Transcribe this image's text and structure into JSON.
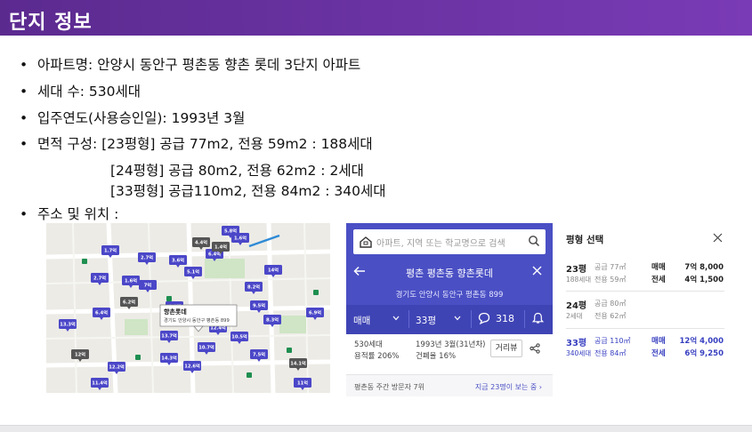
{
  "header": {
    "title": "단지 정보"
  },
  "bullets": {
    "name": "아파트명: 안양시 동안구 평촌동 향촌 롯데 3단지 아파트",
    "households": "세대 수: 530세대",
    "move_in": "입주연도(사용승인일): 1993년 3월",
    "area_intro": "면적 구성: [23평형] 공급 77m2, 전용 59m2 : 188세대",
    "area_24": "[24평형] 공급 80m2, 전용 62m2 : 2세대",
    "area_33": "[33평형] 공급110m2, 전용 84m2 : 340세대",
    "address": "주소   및 위치 :"
  },
  "map": {
    "callout_line1": "향촌롯데",
    "callout_line2": "경기도 안양시 동안구 평촌동 899",
    "pins": [
      "1.7억",
      "2.7억",
      "3.6억",
      "4.4억",
      "6.4억",
      "5.8억",
      "1.6억",
      "2.7억",
      "7억",
      "5.1억",
      "6.2억",
      "6.4억",
      "12.4억",
      "13.3억",
      "10.5억",
      "4.4억",
      "13.7억",
      "12억",
      "12.2억",
      "9.5억",
      "8.2억",
      "12.6억",
      "11.4억",
      "14.3억",
      "14.1억",
      "10.7억",
      "7.5억",
      "6.9억",
      "8.3억",
      "11억",
      "14억",
      "1.4억",
      "1.6억"
    ],
    "colors": {
      "pin": "#4b47c8",
      "pin_gray": "#555555",
      "pin_green": "#1e8f50",
      "road": "#ffffff",
      "park": "#cfe5c5"
    }
  },
  "phone": {
    "search_placeholder": "아파트, 지역 또는 학교명으로 검색",
    "title": "평촌 평촌동 향촌롯데",
    "address": "경기도 안양시 동안구 평촌동 899",
    "tab_sale": "매매",
    "tab_size": "33평",
    "comment_count": "318",
    "info_households": "530세대",
    "info_floor_ratio": "용적률 206%",
    "info_built": "1993년 3월(31년차)",
    "info_coverage": "건폐율 16%",
    "review_button": "거리뷰",
    "visitor_rank": "평촌동 주간 방문자 7위",
    "visitor_now": "지금 23명이 보는 중",
    "colors": {
      "accent": "#4a4fc4"
    }
  },
  "sizes": {
    "title": "평형 선택",
    "rows": [
      {
        "name": "23평",
        "households": "188세대",
        "supply": "공급 77㎡",
        "exclusive": "전용 59㎡",
        "t1": "매매",
        "p1": "7억 8,000",
        "t2": "전세",
        "p2": "4억 1,500",
        "selected": false
      },
      {
        "name": "24평",
        "households": "2세대",
        "supply": "공급 80㎡",
        "exclusive": "전용 62㎡",
        "t1": "",
        "p1": "",
        "t2": "",
        "p2": "",
        "selected": false
      },
      {
        "name": "33평",
        "households": "340세대",
        "supply": "공급 110㎡",
        "exclusive": "전용 84㎡",
        "t1": "매매",
        "p1": "12억 4,000",
        "t2": "전세",
        "p2": "6억 9,250",
        "selected": true
      }
    ]
  }
}
